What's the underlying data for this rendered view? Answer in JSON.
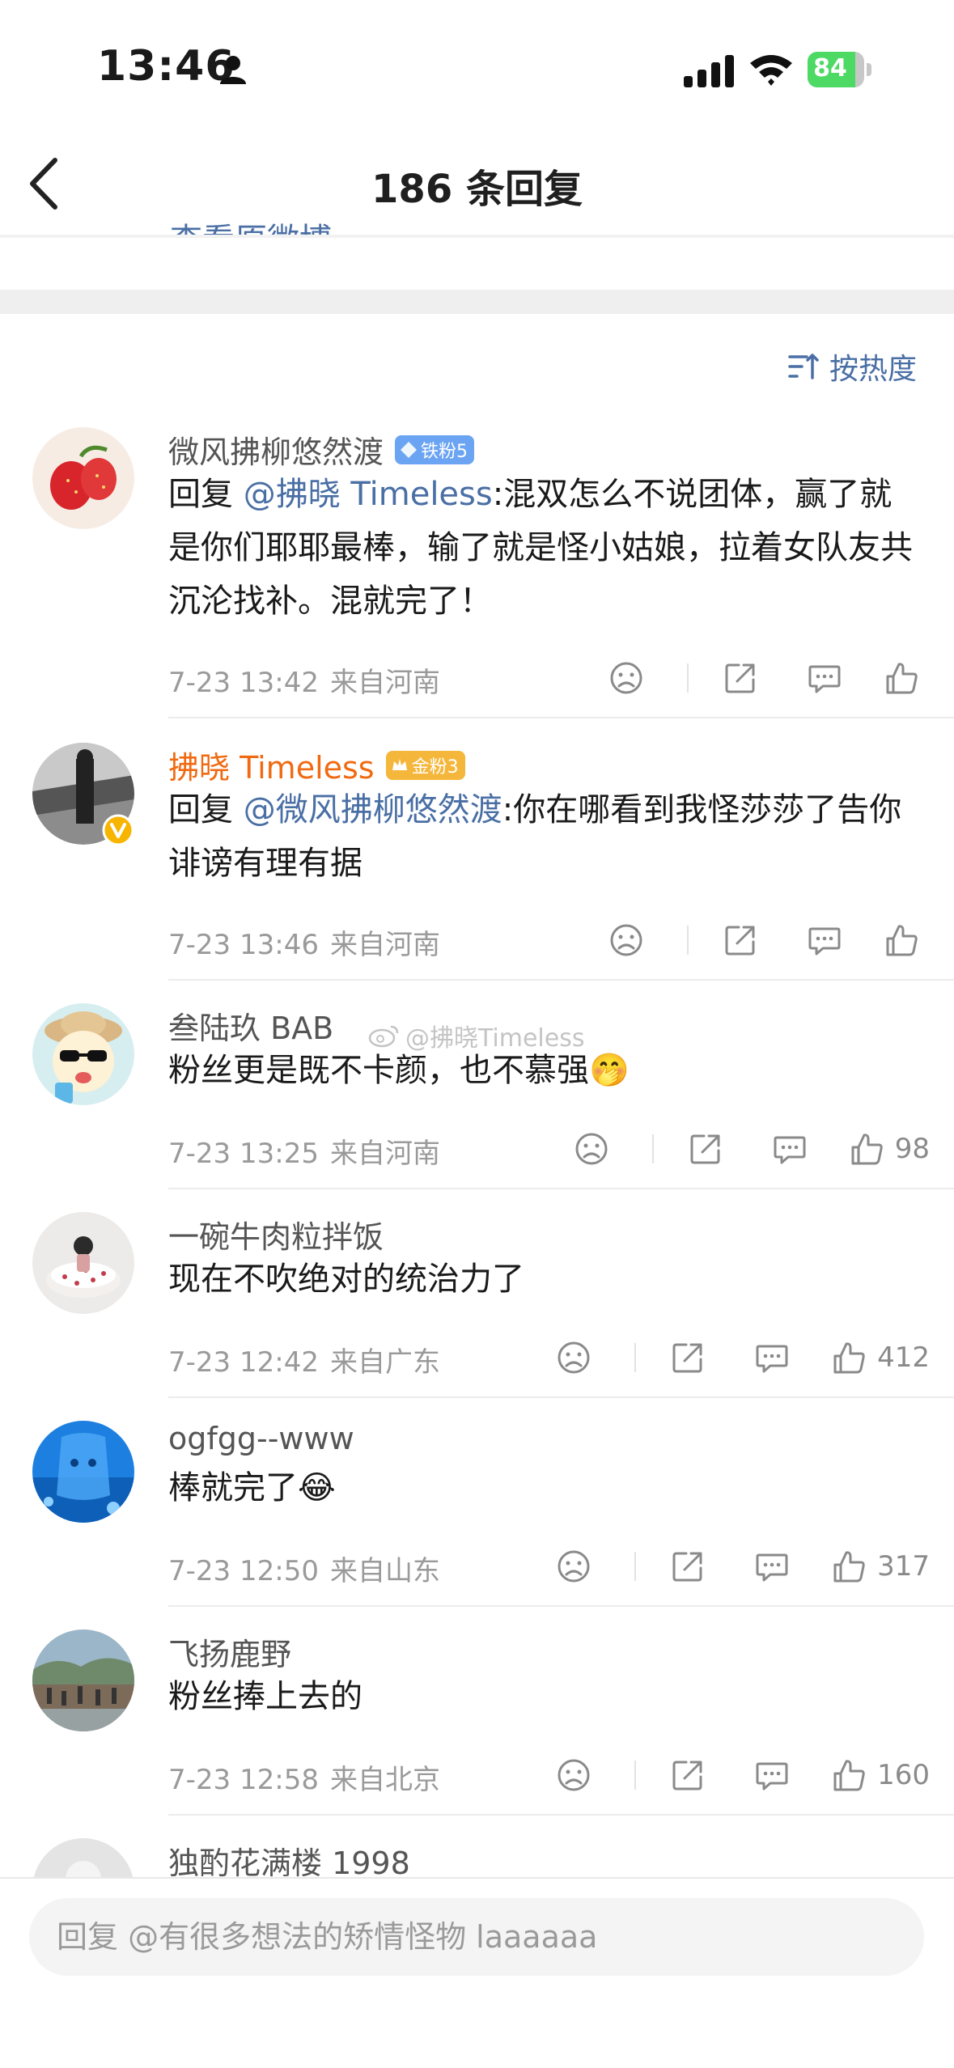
{
  "status_bar": {
    "time": "13:46",
    "battery": "84",
    "battery_level": 0.84
  },
  "nav": {
    "title": "186 条回复"
  },
  "peek_text": "查看原微博",
  "sort": {
    "label": "按热度"
  },
  "watermark": "@拂晓Timeless",
  "comments": [
    {
      "username": "微风拂柳悠然渡",
      "badge": "铁粉5",
      "reply_prefix": "回复 ",
      "mention": "@拂晓 Timeless",
      "text": ":混双怎么不说团体，赢了就是你们耶耶最棒，输了就是怪小姑娘，拉着女队友共沉沦找补。混就完了！",
      "date": "7-23 13:42",
      "location": "来自河南",
      "likes": ""
    },
    {
      "username": "拂晓 Timeless",
      "badge": "金粉3",
      "reply_prefix": "回复 ",
      "mention": "@微风拂柳悠然渡",
      "text": ":你在哪看到我怪莎莎了告你诽谤有理有据",
      "date": "7-23 13:46",
      "location": "来自河南",
      "likes": ""
    },
    {
      "username": "叁陆玖 BAB",
      "text": "粉丝更是既不卡颜，也不慕强",
      "emoji": "🤭",
      "date": "7-23 13:25",
      "location": "来自河南",
      "likes": "98"
    },
    {
      "username": "一碗牛肉粒拌饭",
      "text": "现在不吹绝对的统治力了",
      "date": "7-23 12:42",
      "location": "来自广东",
      "likes": "412"
    },
    {
      "username": "ogfgg--www",
      "text": "棒就完了",
      "emoji": "😂",
      "date": "7-23 12:50",
      "location": "来自山东",
      "likes": "317"
    },
    {
      "username": "飞扬鹿野",
      "text": "粉丝捧上去的",
      "date": "7-23 12:58",
      "location": "来自北京",
      "likes": "160"
    },
    {
      "username": "独酌花满楼 1998"
    }
  ],
  "reply_bar": {
    "placeholder": "回复 @有很多想法的矫情怪物 laaaaaa"
  }
}
